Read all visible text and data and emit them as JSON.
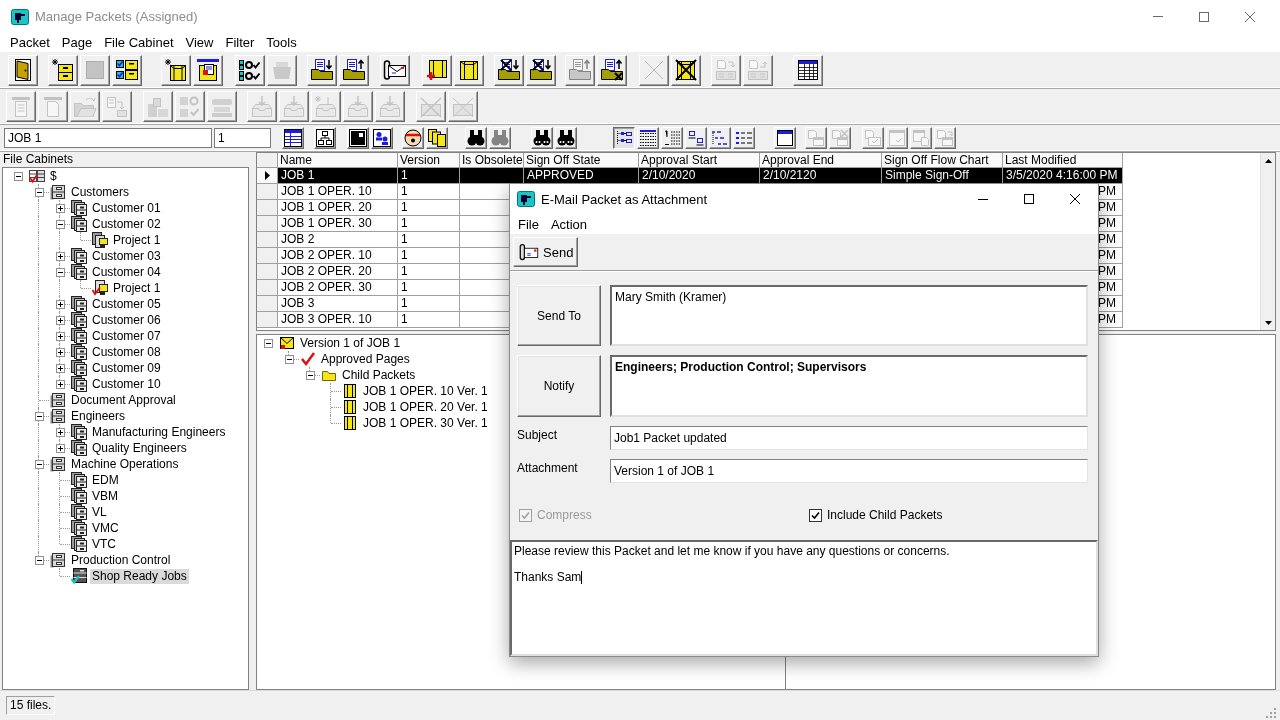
{
  "window": {
    "title": "Manage Packets (Assigned)"
  },
  "menu": [
    "Packet",
    "Page",
    "File Cabinet",
    "View",
    "Filter",
    "Tools"
  ],
  "toolbar_1": [
    [
      {
        "disabled": false
      }
    ],
    [
      {
        "disabled": false
      },
      {
        "disabled": true
      },
      {
        "disabled": false
      }
    ],
    [
      {
        "disabled": false
      },
      {
        "disabled": false
      }
    ],
    [
      {
        "disabled": false
      },
      {
        "disabled": true
      }
    ],
    [
      {
        "disabled": false
      },
      {
        "disabled": false
      }
    ],
    [
      {
        "disabled": false
      }
    ],
    [
      {
        "disabled": false
      },
      {
        "disabled": false
      }
    ],
    [
      {
        "disabled": false
      },
      {
        "disabled": false
      }
    ],
    [
      {
        "disabled": true
      },
      {
        "disabled": false
      }
    ],
    [
      {
        "disabled": true
      },
      {
        "disabled": false
      }
    ],
    [
      {
        "disabled": true
      },
      {
        "disabled": true
      }
    ],
    [
      {
        "disabled": false
      }
    ]
  ],
  "toolbar_2": [
    [
      {
        "disabled": true
      },
      {
        "disabled": true
      },
      {
        "disabled": true
      },
      {
        "disabled": true
      }
    ],
    [
      {
        "disabled": true
      },
      {
        "disabled": true
      },
      {
        "disabled": true
      }
    ],
    [
      {
        "disabled": true
      },
      {
        "disabled": true
      },
      {
        "disabled": true
      },
      {
        "disabled": true
      },
      {
        "disabled": true
      }
    ],
    [
      {
        "disabled": true
      },
      {
        "disabled": true
      }
    ]
  ],
  "toolbar_3": {
    "packet_field": {
      "value": "JOB 1"
    },
    "version_field": {
      "value": "1"
    },
    "buttons": [
      [
        {
          "disabled": false,
          "pressed": false
        }
      ],
      [
        {
          "disabled": false,
          "pressed": false
        }
      ],
      [
        {
          "disabled": false,
          "pressed": false
        },
        {
          "disabled": false,
          "pressed": false
        }
      ],
      [
        {
          "disabled": false,
          "pressed": false
        },
        {
          "disabled": false,
          "pressed": false
        }
      ],
      [
        {
          "disabled": false,
          "pressed": false
        },
        {
          "disabled": true,
          "pressed": false
        }
      ],
      [
        {
          "disabled": false,
          "pressed": false
        },
        {
          "disabled": false,
          "pressed": false
        }
      ],
      [
        {
          "disabled": false,
          "pressed": true
        },
        {
          "disabled": false,
          "pressed": false
        },
        {
          "disabled": false,
          "pressed": false
        },
        {
          "disabled": false,
          "pressed": false
        },
        {
          "disabled": false,
          "pressed": false
        },
        {
          "disabled": false,
          "pressed": false
        }
      ],
      [
        {
          "disabled": false,
          "pressed": false
        }
      ],
      [
        {
          "disabled": true,
          "pressed": false
        },
        {
          "disabled": true,
          "pressed": false
        }
      ],
      [
        {
          "disabled": true,
          "pressed": false
        },
        {
          "disabled": true,
          "pressed": false
        },
        {
          "disabled": true,
          "pressed": false
        },
        {
          "disabled": true,
          "pressed": false
        }
      ]
    ]
  },
  "file_cabinets": {
    "title": "File Cabinets",
    "tree": [
      {
        "label": "$",
        "kind": "root",
        "expanded": true,
        "selected": false,
        "children": [
          {
            "label": "Customers",
            "kind": "cabinet",
            "expanded": true,
            "selected": false,
            "children": [
              {
                "label": "Customer 01",
                "kind": "drawer",
                "expanded": false,
                "selected": false
              },
              {
                "label": "Customer 02",
                "kind": "drawer",
                "expanded": true,
                "selected": false,
                "children": [
                  {
                    "label": "Project 1",
                    "kind": "project",
                    "selected": false
                  }
                ]
              },
              {
                "label": "Customer 03",
                "kind": "drawer",
                "expanded": false,
                "selected": false
              },
              {
                "label": "Customer 04",
                "kind": "drawer",
                "expanded": true,
                "selected": false,
                "children": [
                  {
                    "label": "Project 1",
                    "kind": "signed_project",
                    "selected": false
                  }
                ]
              },
              {
                "label": "Customer 05",
                "kind": "drawer",
                "expanded": false,
                "selected": false
              },
              {
                "label": "Customer 06",
                "kind": "drawer",
                "expanded": false,
                "selected": false
              },
              {
                "label": "Customer 07",
                "kind": "drawer",
                "expanded": false,
                "selected": false
              },
              {
                "label": "Customer 08",
                "kind": "drawer",
                "expanded": false,
                "selected": false
              },
              {
                "label": "Customer 09",
                "kind": "drawer",
                "expanded": false,
                "selected": false
              },
              {
                "label": "Customer 10",
                "kind": "drawer",
                "expanded": false,
                "selected": false
              }
            ]
          },
          {
            "label": "Document Approval",
            "kind": "cabinet",
            "selected": false
          },
          {
            "label": "Engineers",
            "kind": "cabinet",
            "expanded": true,
            "selected": false,
            "children": [
              {
                "label": "Manufacturing Engineers",
                "kind": "drawer",
                "expanded": false,
                "selected": false
              },
              {
                "label": "Quality Engineers",
                "kind": "drawer",
                "expanded": false,
                "selected": false
              }
            ]
          },
          {
            "label": "Machine Operations",
            "kind": "cabinet",
            "expanded": true,
            "selected": false,
            "children": [
              {
                "label": "EDM",
                "kind": "drawer",
                "selected": false
              },
              {
                "label": "VBM",
                "kind": "drawer",
                "selected": false
              },
              {
                "label": "VL",
                "kind": "drawer",
                "selected": false
              },
              {
                "label": "VMC",
                "kind": "drawer",
                "selected": false
              },
              {
                "label": "VTC",
                "kind": "drawer",
                "selected": false
              }
            ]
          },
          {
            "label": "Production Control",
            "kind": "cabinet",
            "expanded": true,
            "selected": false,
            "children": [
              {
                "label": "Shop Ready Jobs",
                "kind": "queue",
                "selected": true
              }
            ]
          }
        ]
      }
    ]
  },
  "table": {
    "columns": [
      "Name",
      "Version",
      "Is Obsolete",
      "Sign Off State",
      "Approval Start",
      "Approval End",
      "Sign Off Flow Chart",
      "Last Modified"
    ],
    "rows": [
      {
        "selected": true,
        "name": "JOB 1",
        "version": "1",
        "sign_off_state": "APPROVED",
        "approval_start": "2/10/2020",
        "approval_end": "2/10/2120",
        "sign_off_flow_chart": "Simple Sign-Off",
        "last_modified": "3/5/2020 4:16:00 PM"
      },
      {
        "selected": false,
        "name": "JOB 1 OPER. 10",
        "version": "1",
        "last_modified": "PM"
      },
      {
        "selected": false,
        "name": "JOB 1 OPER. 20",
        "version": "1",
        "last_modified": "PM"
      },
      {
        "selected": false,
        "name": "JOB 1 OPER. 30",
        "version": "1",
        "last_modified": "PM"
      },
      {
        "selected": false,
        "name": "JOB 2",
        "version": "1",
        "last_modified": "PM"
      },
      {
        "selected": false,
        "name": "JOB 2 OPER. 10",
        "version": "1",
        "last_modified": "PM"
      },
      {
        "selected": false,
        "name": "JOB 2 OPER. 20",
        "version": "1",
        "last_modified": "PM"
      },
      {
        "selected": false,
        "name": "JOB 2 OPER. 30",
        "version": "1",
        "last_modified": "PM"
      },
      {
        "selected": false,
        "name": "JOB 3",
        "version": "1",
        "last_modified": "PM"
      },
      {
        "selected": false,
        "name": "JOB 3 OPER. 10",
        "version": "1",
        "last_modified": "PM"
      }
    ]
  },
  "packet_tree": [
    {
      "label": "Version 1 of JOB 1",
      "kind": "packet",
      "expanded": true,
      "children": [
        {
          "label": "Approved Pages",
          "kind": "approved",
          "expanded": true,
          "children": [
            {
              "label": "Child Packets",
              "kind": "folder",
              "expanded": true,
              "children": [
                {
                  "label": "JOB 1 OPER. 10 Ver. 1",
                  "kind": "child_packet"
                },
                {
                  "label": "JOB 1 OPER. 20 Ver. 1",
                  "kind": "child_packet"
                },
                {
                  "label": "JOB 1 OPER. 30 Ver. 1",
                  "kind": "child_packet"
                }
              ]
            }
          ]
        }
      ]
    }
  ],
  "status_bar": {
    "text": "15 files."
  },
  "email_dialog": {
    "title": "E-Mail Packet as Attachment",
    "menu": [
      "File",
      "Action"
    ],
    "send_button": "Send",
    "send_to": {
      "button": "Send To",
      "value": "Mary Smith (Kramer)"
    },
    "notify": {
      "button": "Notify",
      "value": "Engineers; Production Control; Supervisors"
    },
    "subject": {
      "label": "Subject",
      "value": "Job1 Packet updated"
    },
    "attachment": {
      "label": "Attachment",
      "value": "Version 1 of JOB 1"
    },
    "options": [
      {
        "label": "Compress",
        "checked": true,
        "disabled": true
      },
      {
        "label": "Include Child Packets",
        "checked": true,
        "disabled": false
      }
    ],
    "message": {
      "value": "Please review this Packet and let me know if you have any questions or concerns.\n\nThanks Sam"
    }
  }
}
